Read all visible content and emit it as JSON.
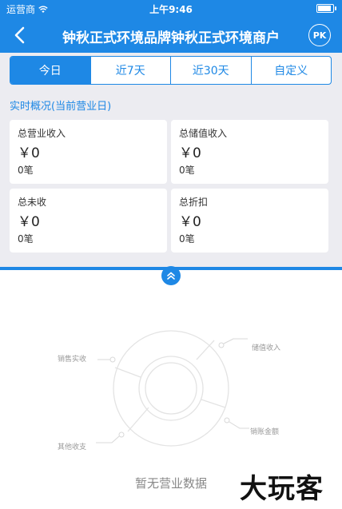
{
  "status_bar": {
    "carrier": "运营商",
    "time": "上午9:46"
  },
  "nav": {
    "title": "钟秋正式环境品牌钟秋正式环境商户",
    "avatar": "PK"
  },
  "tabs": [
    {
      "label": "今日",
      "active": true
    },
    {
      "label": "近7天",
      "active": false
    },
    {
      "label": "近30天",
      "active": false
    },
    {
      "label": "自定义",
      "active": false
    }
  ],
  "overview": {
    "heading": "实时概况(当前营业日)",
    "cards": [
      {
        "label": "总营业收入",
        "amount": "￥0",
        "count": "0笔"
      },
      {
        "label": "总储值收入",
        "amount": "￥0",
        "count": "0笔"
      },
      {
        "label": "总未收",
        "amount": "￥0",
        "count": "0笔"
      },
      {
        "label": "总折扣",
        "amount": "￥0",
        "count": "0笔"
      }
    ]
  },
  "donut": {
    "labels": [
      "销售实收",
      "储值收入",
      "销账金额",
      "其他收支"
    ],
    "empty_text": "暂无营业数据"
  },
  "watermark": "大玩客",
  "colors": {
    "primary": "#1e88e5",
    "panel_bg": "#ececf1"
  }
}
